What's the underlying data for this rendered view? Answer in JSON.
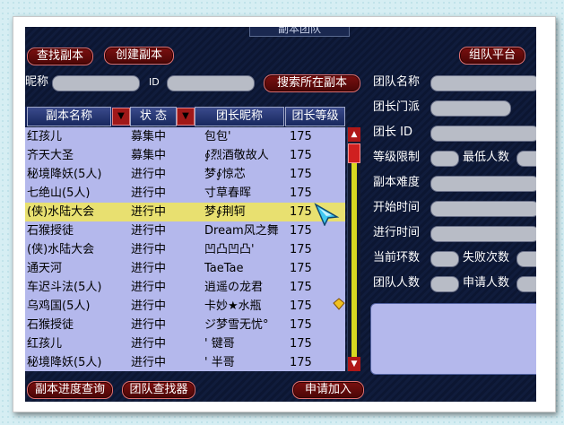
{
  "window": {
    "title": "副本团队"
  },
  "buttons": {
    "find_instance": "查找副本",
    "create_instance": "创建副本",
    "team_platform": "组队平台",
    "search_instance": "搜索所在副本",
    "progress_query": "副本进度查询",
    "team_finder": "团队查找器",
    "apply_join": "申请加入"
  },
  "search": {
    "nickname_label": "昵称",
    "nickname_value": "",
    "id_label": "ID",
    "id_value": ""
  },
  "table": {
    "headers": [
      "副本名称",
      "状 态",
      "团长昵称",
      "团长等级"
    ],
    "sort_icon": "▼",
    "rows": [
      {
        "name": "红孩儿",
        "status": "募集中",
        "leader": "包包'",
        "level": "175"
      },
      {
        "name": "齐天大圣",
        "status": "募集中",
        "leader": "∮烈酒敬故人",
        "level": "175"
      },
      {
        "name": "秘境降妖(5人)",
        "status": "进行中",
        "leader": "梦∮惊芯",
        "level": "175"
      },
      {
        "name": "七绝山(5人)",
        "status": "进行中",
        "leader": "寸草春晖",
        "level": "175"
      },
      {
        "name": "(侠)水陆大会",
        "status": "进行中",
        "leader": "梦∮荆轲",
        "level": "175"
      },
      {
        "name": "石猴授徒",
        "status": "进行中",
        "leader": "Dream风之舞",
        "level": "175"
      },
      {
        "name": "(侠)水陆大会",
        "status": "进行中",
        "leader": "凹凸凹凸'",
        "level": "175"
      },
      {
        "name": "通天河",
        "status": "进行中",
        "leader": "TaeTae",
        "level": "175"
      },
      {
        "name": "车迟斗法(5人)",
        "status": "进行中",
        "leader": "逍遥の龙君",
        "level": "175"
      },
      {
        "name": "乌鸡国(5人)",
        "status": "进行中",
        "leader": "卡妙★水瓶",
        "level": "175"
      },
      {
        "name": "石猴授徒",
        "status": "进行中",
        "leader": "ジ梦雪无忧°",
        "level": "175"
      },
      {
        "name": "红孩儿",
        "status": "进行中",
        "leader": "' 键哥",
        "level": "175"
      },
      {
        "name": "秘境降妖(5人)",
        "status": "进行中",
        "leader": "' 半哥",
        "level": "175"
      }
    ],
    "selected_index": 4
  },
  "details": {
    "team_name": "团队名称",
    "leader_sect": "团长门派",
    "leader_id": "团长  ID",
    "level_limit": "等级限制",
    "min_people": "最低人数",
    "difficulty": "副本难度",
    "start_time": "开始时间",
    "elapsed_time": "进行时间",
    "current_round": "当前环数",
    "fail_count": "失败次数",
    "team_size": "团队人数",
    "applicants": "申请人数"
  },
  "icons": {
    "scroll_up": "▲",
    "scroll_down": "▼",
    "cursor": "arrow-cursor-icon",
    "gem": "gold-gem-icon"
  },
  "colors": {
    "window_bg": "#0c1632",
    "button_red": "#7a1010",
    "list_bg": "#b4b8ec",
    "selected_row": "#e8e070"
  }
}
